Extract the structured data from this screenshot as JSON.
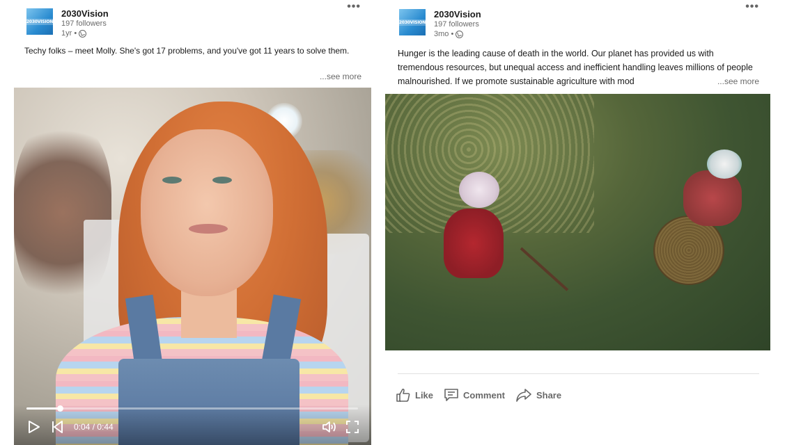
{
  "posts": [
    {
      "company": "2030Vision",
      "logo_text": "2030VISION",
      "followers": "197 followers",
      "age": "1yr •",
      "text": "Techy folks – meet Molly. She's got 17 problems, and you've got 11 years to solve them.",
      "see_more": "...see more",
      "video": {
        "time": "0:04 / 0:44",
        "progress": 0.1
      }
    },
    {
      "company": "2030Vision",
      "logo_text": "2030VISION",
      "followers": "197 followers",
      "age": "3mo •",
      "text": "Hunger is the leading cause of death in the world. Our planet has provided us with tremendous resources, but unequal access and inefficient handling leaves millions of people malnourished. If we promote sustainable agriculture with mod",
      "see_more": "...see more",
      "actions": {
        "like": "Like",
        "comment": "Comment",
        "share": "Share"
      }
    }
  ]
}
